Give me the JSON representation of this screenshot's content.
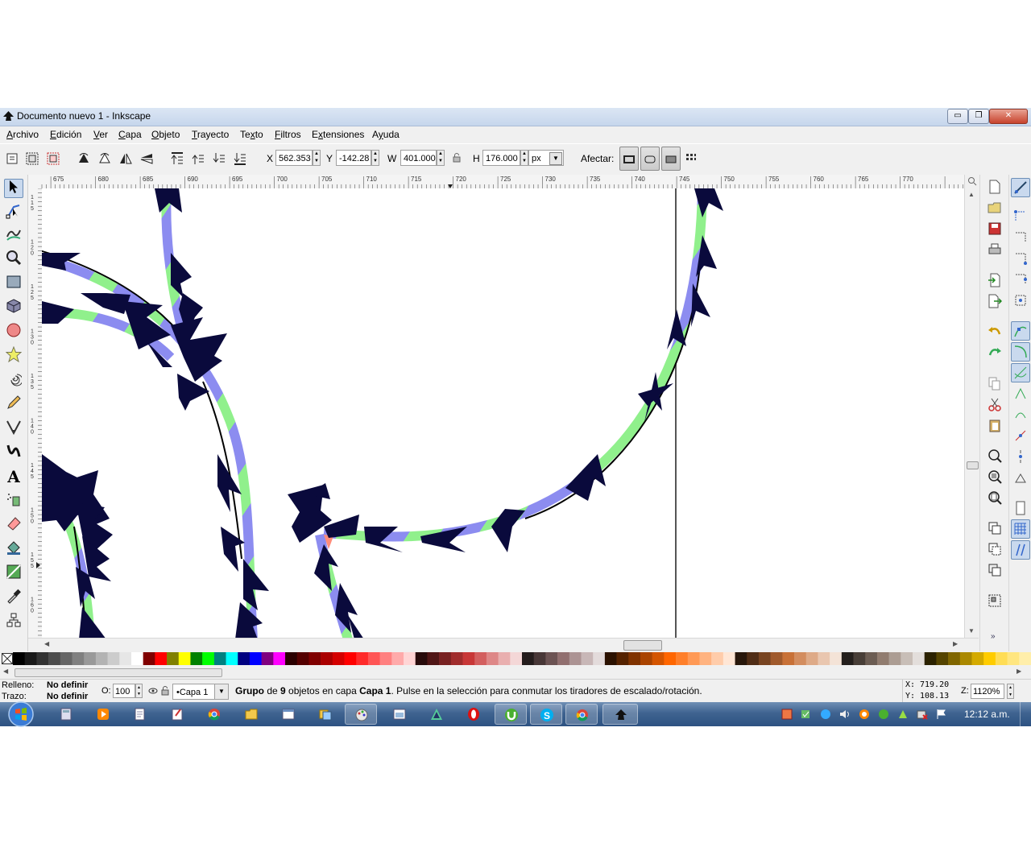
{
  "window": {
    "title": "Documento nuevo 1 - Inkscape",
    "min_glyph": "▭",
    "max_glyph": "❐",
    "close_glyph": "✕"
  },
  "menu": {
    "items": [
      {
        "label": "Archivo",
        "key": "A"
      },
      {
        "label": "Edición",
        "key": "E"
      },
      {
        "label": "Ver",
        "key": "V"
      },
      {
        "label": "Capa",
        "key": "C"
      },
      {
        "label": "Objeto",
        "key": "O"
      },
      {
        "label": "Trayecto",
        "key": "T"
      },
      {
        "label": "Texto",
        "key": "x"
      },
      {
        "label": "Filtros",
        "key": "F"
      },
      {
        "label": "Extensiones",
        "key": "x"
      },
      {
        "label": "Ayuda",
        "key": "y"
      }
    ]
  },
  "toolbar": {
    "x_label": "X",
    "x_value": "562.353",
    "y_label": "Y",
    "y_value": "-142.28",
    "w_label": "W",
    "w_value": "401.000",
    "h_label": "H",
    "h_value": "176.000",
    "unit": "px",
    "affect_label": "Afectar:",
    "lock_icon": "lock-icon"
  },
  "ruler": {
    "h_labels": [
      "675",
      "680",
      "685",
      "690",
      "695",
      "700",
      "705",
      "710",
      "715",
      "720",
      "725",
      "730",
      "735",
      "740",
      "745",
      "750",
      "755",
      "760",
      "765",
      "770"
    ],
    "v_labels": [
      "115",
      "120",
      "125",
      "130",
      "135",
      "140",
      "145",
      "150",
      "155",
      "160",
      "165"
    ]
  },
  "tools": [
    "selector",
    "node",
    "tweak",
    "zoom",
    "rect",
    "3dbox",
    "ellipse",
    "star",
    "spiral",
    "pencil",
    "pen",
    "calligraphy",
    "text",
    "spray",
    "eraser",
    "bucket",
    "gradient",
    "dropper",
    "connector"
  ],
  "colors": {
    "accent": "#6d8fb8",
    "path_green": "#90f08c",
    "path_blue": "#8c8cf0",
    "marker": "#0a0a3c",
    "highlight": "#ff8c7a"
  },
  "palette": {
    "swatches": [
      "#000000",
      "#1a1a1a",
      "#333333",
      "#4d4d4d",
      "#666666",
      "#808080",
      "#999999",
      "#b3b3b3",
      "#cccccc",
      "#e6e6e6",
      "#ffffff",
      "#800000",
      "#ff0000",
      "#808000",
      "#ffff00",
      "#008000",
      "#00ff00",
      "#008080",
      "#00ffff",
      "#000080",
      "#0000ff",
      "#800080",
      "#ff00ff",
      "#2b0000",
      "#550000",
      "#800000",
      "#aa0000",
      "#d40000",
      "#ff0000",
      "#ff2a2a",
      "#ff5555",
      "#ff8080",
      "#ffaaaa",
      "#ffd5d5",
      "#280b0b",
      "#501616",
      "#782121",
      "#a02c2c",
      "#c83737",
      "#d35f5f",
      "#de8787",
      "#e9afaf",
      "#f4d7d7",
      "#241c1c",
      "#483737",
      "#6c5353",
      "#916f6f",
      "#ac9393",
      "#c8b7b7",
      "#e3dbdb",
      "#2b1100",
      "#552200",
      "#803300",
      "#aa4400",
      "#d45500",
      "#ff6600",
      "#ff7f2a",
      "#ff9955",
      "#ffb380",
      "#ffccaa",
      "#ffe6d5",
      "#28170b",
      "#502d16",
      "#784421",
      "#a05a2c",
      "#c87137",
      "#d38d5f",
      "#deaa87",
      "#e9c6af",
      "#f4e3d7",
      "#241f1c",
      "#483e37",
      "#6c5d53",
      "#917c6f",
      "#ac9d93",
      "#c8beb7",
      "#e3dedb",
      "#2b2200",
      "#554400",
      "#806600",
      "#aa8800",
      "#d4aa00",
      "#ffcc00",
      "#ffdd55",
      "#ffe680",
      "#ffeeaa"
    ]
  },
  "status": {
    "fill_label": "Relleno:",
    "fill_value": "No definir",
    "stroke_label": "Trazo:",
    "stroke_value": "No definir",
    "opacity_label": "O:",
    "opacity_value": "100",
    "layer": "•Capa 1",
    "message_bold1": "Grupo",
    "message_part1": " de ",
    "message_bold2": "9",
    "message_part2": " objetos en capa ",
    "message_bold3": "Capa 1",
    "message_part3": ". Pulse en la selección para conmutar los tiradores de escalado/rotación.",
    "cursor_x_label": "X:",
    "cursor_x": "719.20",
    "cursor_y_label": "Y:",
    "cursor_y": "108.13",
    "zoom_label": "Z:",
    "zoom": "1120%"
  },
  "taskbar": {
    "clock": "12:12 a.m.",
    "apps": [
      "calculator",
      "media",
      "documents",
      "notes",
      "chrome",
      "explorer",
      "window",
      "folder",
      "paint",
      "window2",
      "inkscape-a",
      "opera",
      "utorrent",
      "skype",
      "chrome2",
      "inkscape"
    ]
  }
}
